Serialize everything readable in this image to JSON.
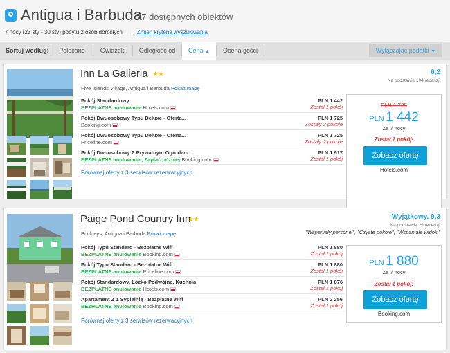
{
  "header": {
    "title": "Antigua i Barbuda",
    "count": "77 dostępnych obiektów",
    "subtitle": "7 nocy (23 sty - 30 sty) pobytu 2 osób dorosłych",
    "change_link": "Zmień kryteria wyszukiwania"
  },
  "sortbar": {
    "label": "Sortuj według:",
    "options": [
      "Polecane",
      "Gwiazdki",
      "Odległość od",
      "Cena",
      "Ocena gości"
    ],
    "active": "Cena",
    "tax_filter": "Wyłączając podatki"
  },
  "hotels": [
    {
      "name": "Inn La Galleria",
      "stars": "★★",
      "location": "Five Islands Village, Antigua i Barbuda",
      "map_link": "Pokaż mapę",
      "rating_score": "6,2",
      "rating_base": "Na podstawie 104 recenzji",
      "offers": [
        {
          "name": "Pokój Standardowy",
          "free": "BEZPŁATNE anulowanie",
          "extra": "",
          "source": "Hotels.com",
          "price": "PLN 1 442",
          "left": "Został 1 pokój"
        },
        {
          "name": "Pokój Dwuosobowy Typu Deluxe - Oferta...",
          "free": "",
          "extra": "",
          "source": "Booking.com",
          "price": "PLN 1 725",
          "left": "Zostały 2 pokoje"
        },
        {
          "name": "Pokój Dwuosobowy Typu Deluxe - Oferta...",
          "free": "",
          "extra": "",
          "source": "Priceline.com",
          "price": "PLN 1 725",
          "left": "Zostały 2 pokoje"
        },
        {
          "name": "Pokój Dwuosobowy Z Prywatnym Ogrodem...",
          "free": "BEZPŁATNE anulowanie",
          "extra": ", Zapłać później",
          "source": "Booking.com",
          "price": "PLN 1 917",
          "left": "Został 1 pokój"
        }
      ],
      "compare": "Porównaj oferty z 3 serwisów rezerwacyjnych",
      "box": {
        "old_price": "PLN 1 725",
        "currency": "PLN",
        "amount": "1 442",
        "nights": "Za 7 nocy",
        "left": "Został 1 pokój!",
        "button": "Zobacz ofertę",
        "source": "Hotels.com"
      }
    },
    {
      "name": "Paige Pond Country Inn",
      "stars": "★★",
      "location": "Buckleys, Antigua i Barbuda",
      "map_link": "Pokaż mapę",
      "rating_score": "Wyjątkowy, 9,3",
      "rating_base": "Na podstawie 29 recenzji",
      "rating_quotes": "\"Wspaniały personel\", \"Czyste pokoje\", \"Wspaniałe widoki\"",
      "offers": [
        {
          "name": "Pokój Typu Standard - Bezpłatne Wifi",
          "free": "BEZPŁATNE anulowanie",
          "extra": "",
          "source": "Booking.com",
          "price": "PLN 1 880",
          "left": "Został 1 pokój"
        },
        {
          "name": "Pokój Typu Standard - Bezpłatne Wifi",
          "free": "BEZPŁATNE anulowanie",
          "extra": "",
          "source": "Priceline.com",
          "price": "PLN 1 880",
          "left": "Został 1 pokój"
        },
        {
          "name": "Pokój Standardowy, Łóżko Podwójne, Kuchnia",
          "free": "BEZPŁATNE anulowanie",
          "extra": "",
          "source": "Hotels.com",
          "price": "PLN 1 876",
          "left": "Został 1 pokój"
        },
        {
          "name": "Apartament Z 1 Sypialnią - Bezpłatne Wifi",
          "free": "BEZPŁATNE anulowanie",
          "extra": "",
          "source": "Booking.com",
          "price": "PLN 2 256",
          "left": "Został 1 pokój"
        }
      ],
      "compare": "Porównaj oferty z 3 serwisów rezerwacyjnych",
      "box": {
        "currency": "PLN",
        "amount": "1 880",
        "nights": "Za 7 nocy",
        "left": "Został 1 pokój!",
        "button": "Zobacz ofertę",
        "source": "Booking.com"
      }
    }
  ],
  "colors": {
    "accent": "#26a6e8",
    "button": "#0fa0d8",
    "free": "#2db350",
    "warning": "#e03b3b",
    "stars": "#f1c40f"
  }
}
